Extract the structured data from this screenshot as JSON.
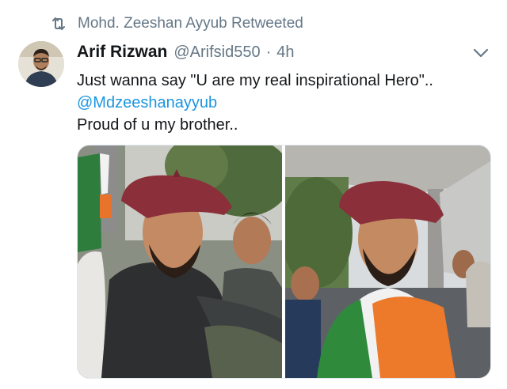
{
  "retweet_context": {
    "icon": "retweet-icon",
    "text": "Mohd. Zeeshan Ayyub Retweeted"
  },
  "author": {
    "avatar": "avatar",
    "name": "Arif Rizwan",
    "handle": "@Arifsid550",
    "separator": "·",
    "time": "4h"
  },
  "menu": {
    "icon": "chevron-down-icon"
  },
  "tweet": {
    "line1": "Just wanna say \"U are my real inspirational Hero\"..",
    "mention": "@Mdzeeshanayyub",
    "line3": "Proud of u my  brother.."
  },
  "media": {
    "count": 2,
    "photos": [
      "photo-1",
      "photo-2"
    ]
  },
  "colors": {
    "text": "#14171a",
    "secondary": "#657786",
    "link": "#1b95e0"
  }
}
